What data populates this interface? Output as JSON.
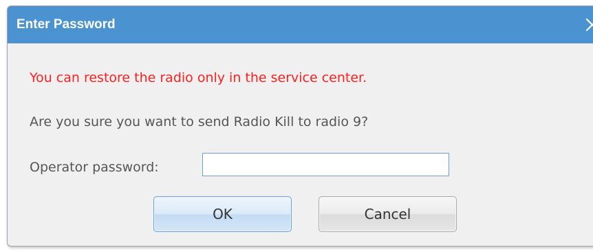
{
  "dialog": {
    "title": "Enter Password",
    "close_icon": "close-icon",
    "warning": "You can restore the radio only in the service center.",
    "question": "Are you sure you want to send Radio Kill to radio 9?",
    "password_label": "Operator password:",
    "password_value": "",
    "ok_label": "OK",
    "cancel_label": "Cancel"
  },
  "colors": {
    "titlebar": "#4a93d0",
    "warning_text": "#ff1f1f",
    "body_text": "#555555",
    "dialog_bg": "#f0f0f0"
  }
}
